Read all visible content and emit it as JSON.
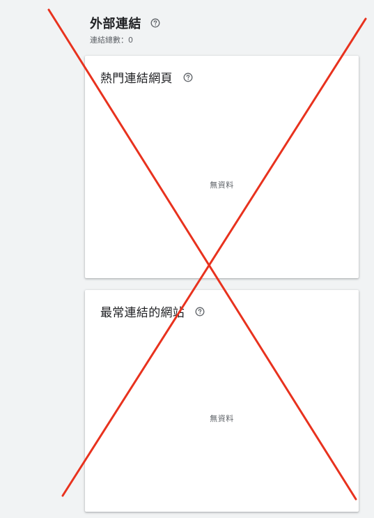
{
  "section": {
    "title": "外部連結",
    "total_label": "連結總數：0",
    "help_icon": "help-circle-icon"
  },
  "cards": [
    {
      "title": "熱門連結網頁",
      "empty_text": "無資料",
      "help_icon": "help-circle-icon"
    },
    {
      "title": "最常連結的網站",
      "empty_text": "無資料",
      "help_icon": "help-circle-icon"
    }
  ],
  "overlay": {
    "type": "cross-out",
    "color": "#e8321e"
  },
  "colors": {
    "background": "#f1f3f4",
    "card": "#ffffff",
    "text_primary": "#202124",
    "text_secondary": "#5f6368"
  }
}
